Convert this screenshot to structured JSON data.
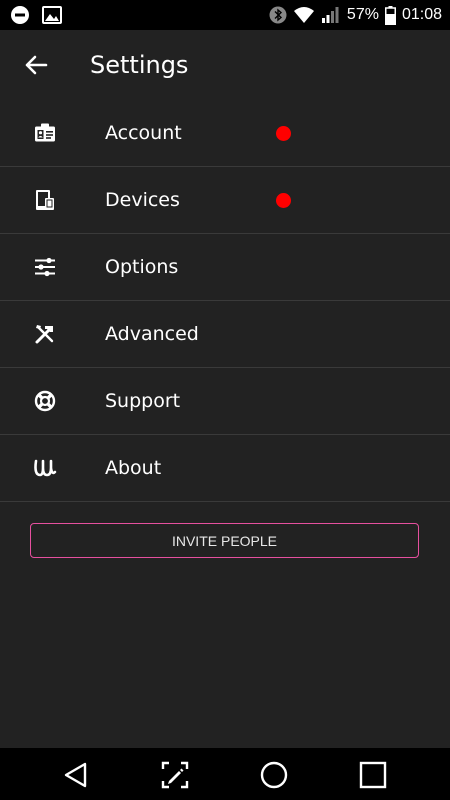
{
  "status_bar": {
    "battery_percent": "57%",
    "time": "01:08",
    "icons": [
      "minus-circle-icon",
      "image-icon",
      "bluetooth-icon",
      "wifi-icon",
      "signal-icon",
      "battery-icon"
    ]
  },
  "header": {
    "title": "Settings",
    "back_icon": "arrow-left-icon"
  },
  "menu": {
    "items": [
      {
        "label": "Account",
        "icon": "id-card-icon",
        "notification": true
      },
      {
        "label": "Devices",
        "icon": "devices-icon",
        "notification": true
      },
      {
        "label": "Options",
        "icon": "sliders-icon",
        "notification": false
      },
      {
        "label": "Advanced",
        "icon": "tools-icon",
        "notification": false
      },
      {
        "label": "Support",
        "icon": "lifebuoy-icon",
        "notification": false
      },
      {
        "label": "About",
        "icon": "w-logo-icon",
        "notification": false
      }
    ],
    "notification_color": "#ff0000"
  },
  "invite": {
    "label": "INVITE PEOPLE",
    "border_color": "#e6509f"
  },
  "nav_bar": {
    "icons": [
      "back-triangle-icon",
      "screen-edit-icon",
      "home-circle-icon",
      "recents-square-icon"
    ]
  },
  "colors": {
    "background": "#222222",
    "status_bar": "#000000",
    "divider": "#3a3a3a",
    "text": "#ffffff"
  }
}
